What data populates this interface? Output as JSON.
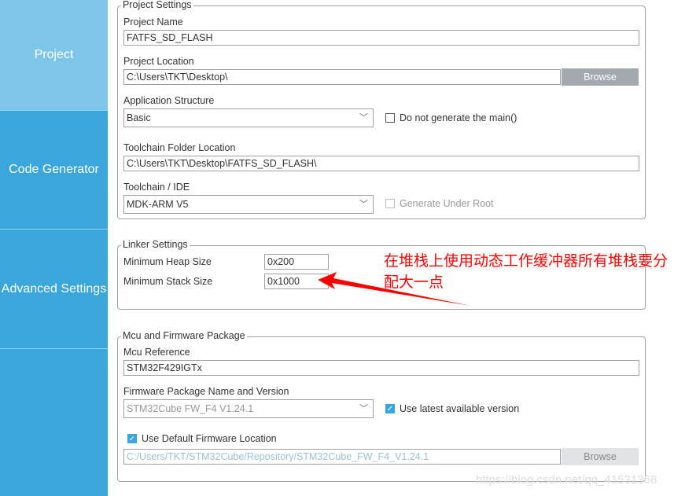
{
  "sidebar": {
    "items": [
      {
        "label": "Project",
        "active": true
      },
      {
        "label": "Code Generator"
      },
      {
        "label": "Advanced Settings"
      },
      {
        "label": ""
      }
    ]
  },
  "project_settings": {
    "legend": "Project Settings",
    "name_label": "Project Name",
    "name_value": "FATFS_SD_FLASH",
    "location_label": "Project Location",
    "location_value": "C:\\Users\\TKT\\Desktop\\",
    "browse": "Browse",
    "app_structure_label": "Application Structure",
    "app_structure_value": "Basic",
    "no_main_label": "Do not generate the main()",
    "no_main_checked": false,
    "toolchain_folder_label": "Toolchain Folder Location",
    "toolchain_folder_value": "C:\\Users\\TKT\\Desktop\\FATFS_SD_FLASH\\",
    "toolchain_label": "Toolchain / IDE",
    "toolchain_value": "MDK-ARM V5",
    "gen_root_label": "Generate Under Root",
    "gen_root_checked": false
  },
  "linker_settings": {
    "legend": "Linker Settings",
    "heap_label": "Minimum Heap Size",
    "heap_value": "0x200",
    "stack_label": "Minimum Stack Size",
    "stack_value": "0x1000"
  },
  "annotation": {
    "text": "在堆栈上使用动态工作缓冲器所有堆栈要分配大一点",
    "color": "#ff0000"
  },
  "mcu": {
    "legend": "Mcu and Firmware Package",
    "ref_label": "Mcu Reference",
    "ref_value": "STM32F429IGTx",
    "fw_label": "Firmware Package Name and Version",
    "fw_value": "STM32Cube FW_F4 V1.24.1",
    "latest_label": "Use latest available version",
    "latest_checked": true,
    "default_loc_label": "Use Default Firmware Location",
    "default_loc_checked": true,
    "fw_location": "C:/Users/TKT/STM32Cube/Repository/STM32Cube_FW_F4_V1.24.1",
    "browse": "Browse"
  },
  "watermark": "https://blog.csdn.net/qq_41531368"
}
